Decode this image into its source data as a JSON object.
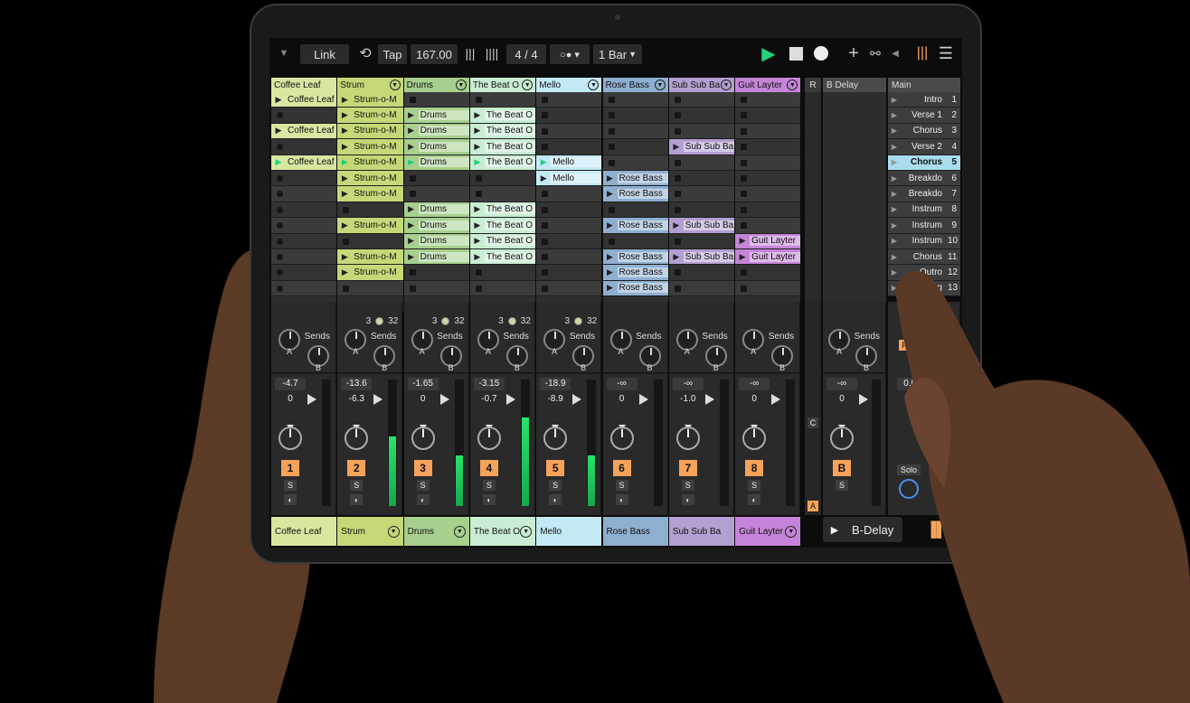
{
  "toolbar": {
    "link_label": "Link",
    "tap_label": "Tap",
    "tempo": "167.00",
    "time_signature": "4 / 4",
    "quantization": "1 Bar",
    "tempo_nudge_icon": "nudge-bars-icon"
  },
  "tracks": [
    {
      "name": "Coffee Leaf",
      "color": "#d7e7a0",
      "number": "1",
      "vol": "-4.7",
      "vol2": "0",
      "meter": 0
    },
    {
      "name": "Strum",
      "color": "#c5d878",
      "number": "2",
      "vol": "-13.6",
      "vol2": "-6.3",
      "meter": 0.55
    },
    {
      "name": "Drums",
      "color": "#a7cf8e",
      "number": "3",
      "vol": "-1.65",
      "vol2": "0",
      "meter": 0.4
    },
    {
      "name": "The Beat O",
      "color": "#c9edd3",
      "number": "4",
      "vol": "-3.15",
      "vol2": "-0.7",
      "meter": 0.7
    },
    {
      "name": "Mello",
      "color": "#c4e9f5",
      "number": "5",
      "vol": "-18.9",
      "vol2": "-8.9",
      "meter": 0.4
    },
    {
      "name": "Rose Bass",
      "color": "#8fafd0",
      "number": "6",
      "vol": "-∞",
      "vol2": "0",
      "meter": 0
    },
    {
      "name": "Sub Sub Ba",
      "color": "#b39fd2",
      "number": "7",
      "vol": "-∞",
      "vol2": "-1.0",
      "meter": 0
    },
    {
      "name": "Guit Layter",
      "color": "#c584d8",
      "number": "8",
      "vol": "-∞",
      "vol2": "0",
      "meter": 0
    }
  ],
  "track_status": [
    {
      "count": "3",
      "total": "32"
    },
    {
      "count": "3",
      "total": "32"
    },
    {
      "count": "3",
      "total": "32"
    },
    {
      "count": "3",
      "total": "32"
    },
    {
      "count": "3",
      "total": "32"
    }
  ],
  "clips": [
    [
      "Coffee Leaf",
      "",
      "Coffee Leaf",
      "",
      "Coffee Leaf",
      "",
      "",
      "",
      "",
      "",
      "",
      "",
      ""
    ],
    [
      "Strum-o-M",
      "Strum-o-M",
      "Strum-o-M",
      "Strum-o-M",
      "Strum-o-M",
      "Strum-o-M",
      "Strum-o-M",
      "",
      "Strum-o-M",
      "",
      "Strum-o-M",
      "Strum-o-M",
      ""
    ],
    [
      "",
      "Drums",
      "Drums",
      "Drums",
      "Drums",
      "",
      "",
      "Drums",
      "Drums",
      "Drums",
      "Drums",
      "",
      ""
    ],
    [
      "",
      "The Beat O",
      "The Beat O",
      "The Beat O",
      "The Beat O",
      "",
      "",
      "The Beat O",
      "The Beat O",
      "The Beat O",
      "The Beat O",
      "",
      ""
    ],
    [
      "",
      "",
      "",
      "",
      "Mello",
      "Mello",
      "",
      "",
      "",
      "",
      "",
      "",
      ""
    ],
    [
      "",
      "",
      "",
      "",
      "",
      "Rose Bass",
      "Rose Bass",
      "",
      "Rose Bass",
      "",
      "Rose Bass",
      "Rose Bass",
      "Rose Bass"
    ],
    [
      "",
      "",
      "",
      "Sub Sub Ba",
      "",
      "",
      "",
      "",
      "Sub Sub Ba",
      "",
      "Sub Sub Ba",
      "",
      ""
    ],
    [
      "",
      "",
      "",
      "",
      "",
      "",
      "",
      "",
      "",
      "Guit Layter",
      "Guit Layter",
      "",
      ""
    ]
  ],
  "playing_row": 4,
  "return_track": {
    "header": "R",
    "name": "B Delay",
    "bottom_name": "B-Delay",
    "letter": "B",
    "vol": "-∞",
    "vol2": "0",
    "sends_label": "Sends",
    "send_a": "A",
    "send_b": "B"
  },
  "mixer_labels": {
    "sends": "Sends",
    "send_a": "A",
    "send_b": "B",
    "solo": "S",
    "c_label": "C",
    "a_label": "A"
  },
  "main": {
    "header": "Main",
    "vol": "0.00",
    "solo_label": "Solo",
    "post_label": "Pos",
    "scenes": [
      {
        "name": "Intro",
        "index": "1"
      },
      {
        "name": "Verse 1",
        "index": "2"
      },
      {
        "name": "Chorus",
        "index": "3"
      },
      {
        "name": "Verse 2",
        "index": "4"
      },
      {
        "name": "Chorus",
        "index": "5"
      },
      {
        "name": "Breakdo",
        "index": "6"
      },
      {
        "name": "Breakdo",
        "index": "7"
      },
      {
        "name": "Instrum",
        "index": "8"
      },
      {
        "name": "Instrum",
        "index": "9"
      },
      {
        "name": "Instrum",
        "index": "10"
      },
      {
        "name": "Chorus",
        "index": "11"
      },
      {
        "name": "Outro",
        "index": "12"
      },
      {
        "name": "...ling",
        "index": "13"
      }
    ],
    "active_scene": 4
  }
}
